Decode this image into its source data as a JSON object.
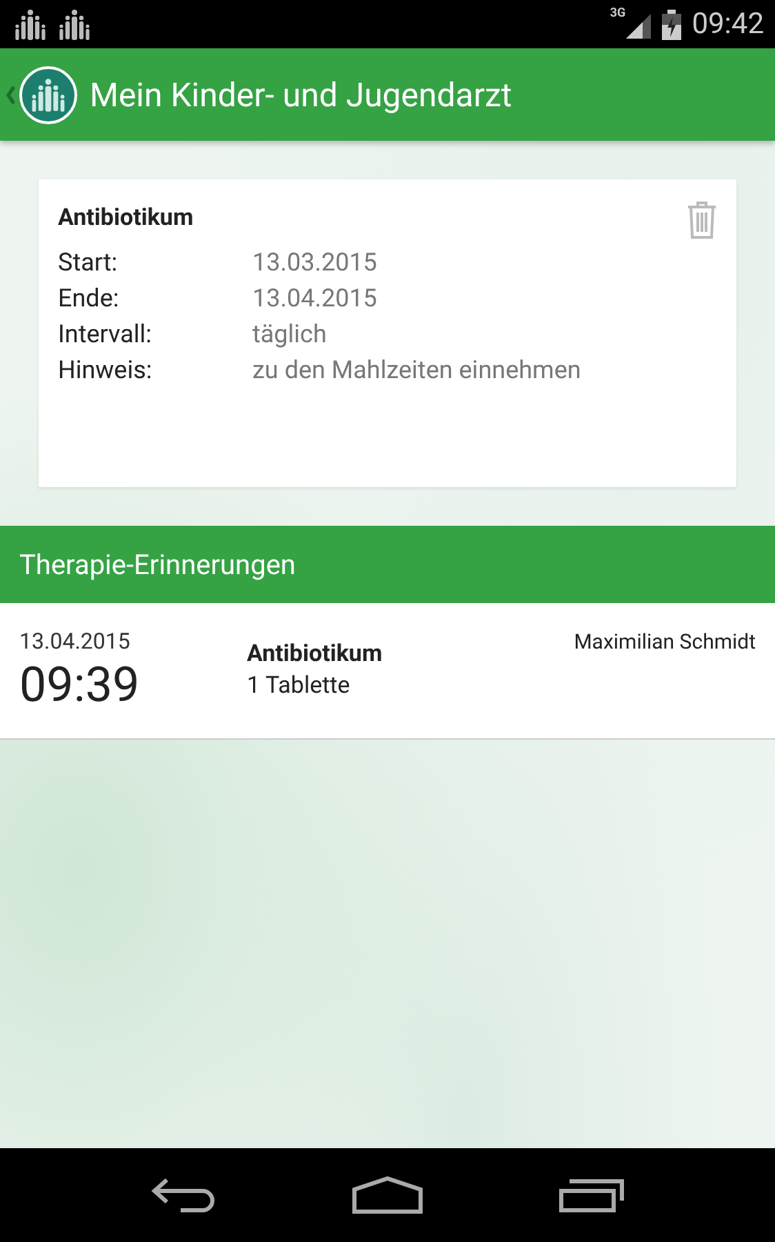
{
  "status_bar": {
    "time": "09:42",
    "network": "3G"
  },
  "app_bar": {
    "title": "Mein Kinder- und Jugendarzt"
  },
  "medication": {
    "name": "Antibiotikum",
    "fields": [
      {
        "label": "Start:",
        "value": "13.03.2015"
      },
      {
        "label": "Ende:",
        "value": "13.04.2015"
      },
      {
        "label": "Intervall:",
        "value": "täglich"
      },
      {
        "label": "Hinweis:",
        "value": "zu den Mahlzeiten einnehmen"
      }
    ]
  },
  "section": {
    "title": "Therapie-Erinnerungen"
  },
  "reminders": [
    {
      "date": "13.04.2015",
      "time": "09:39",
      "medication": "Antibiotikum",
      "dose": "1 Tablette",
      "patient": "Maximilian Schmidt"
    }
  ]
}
